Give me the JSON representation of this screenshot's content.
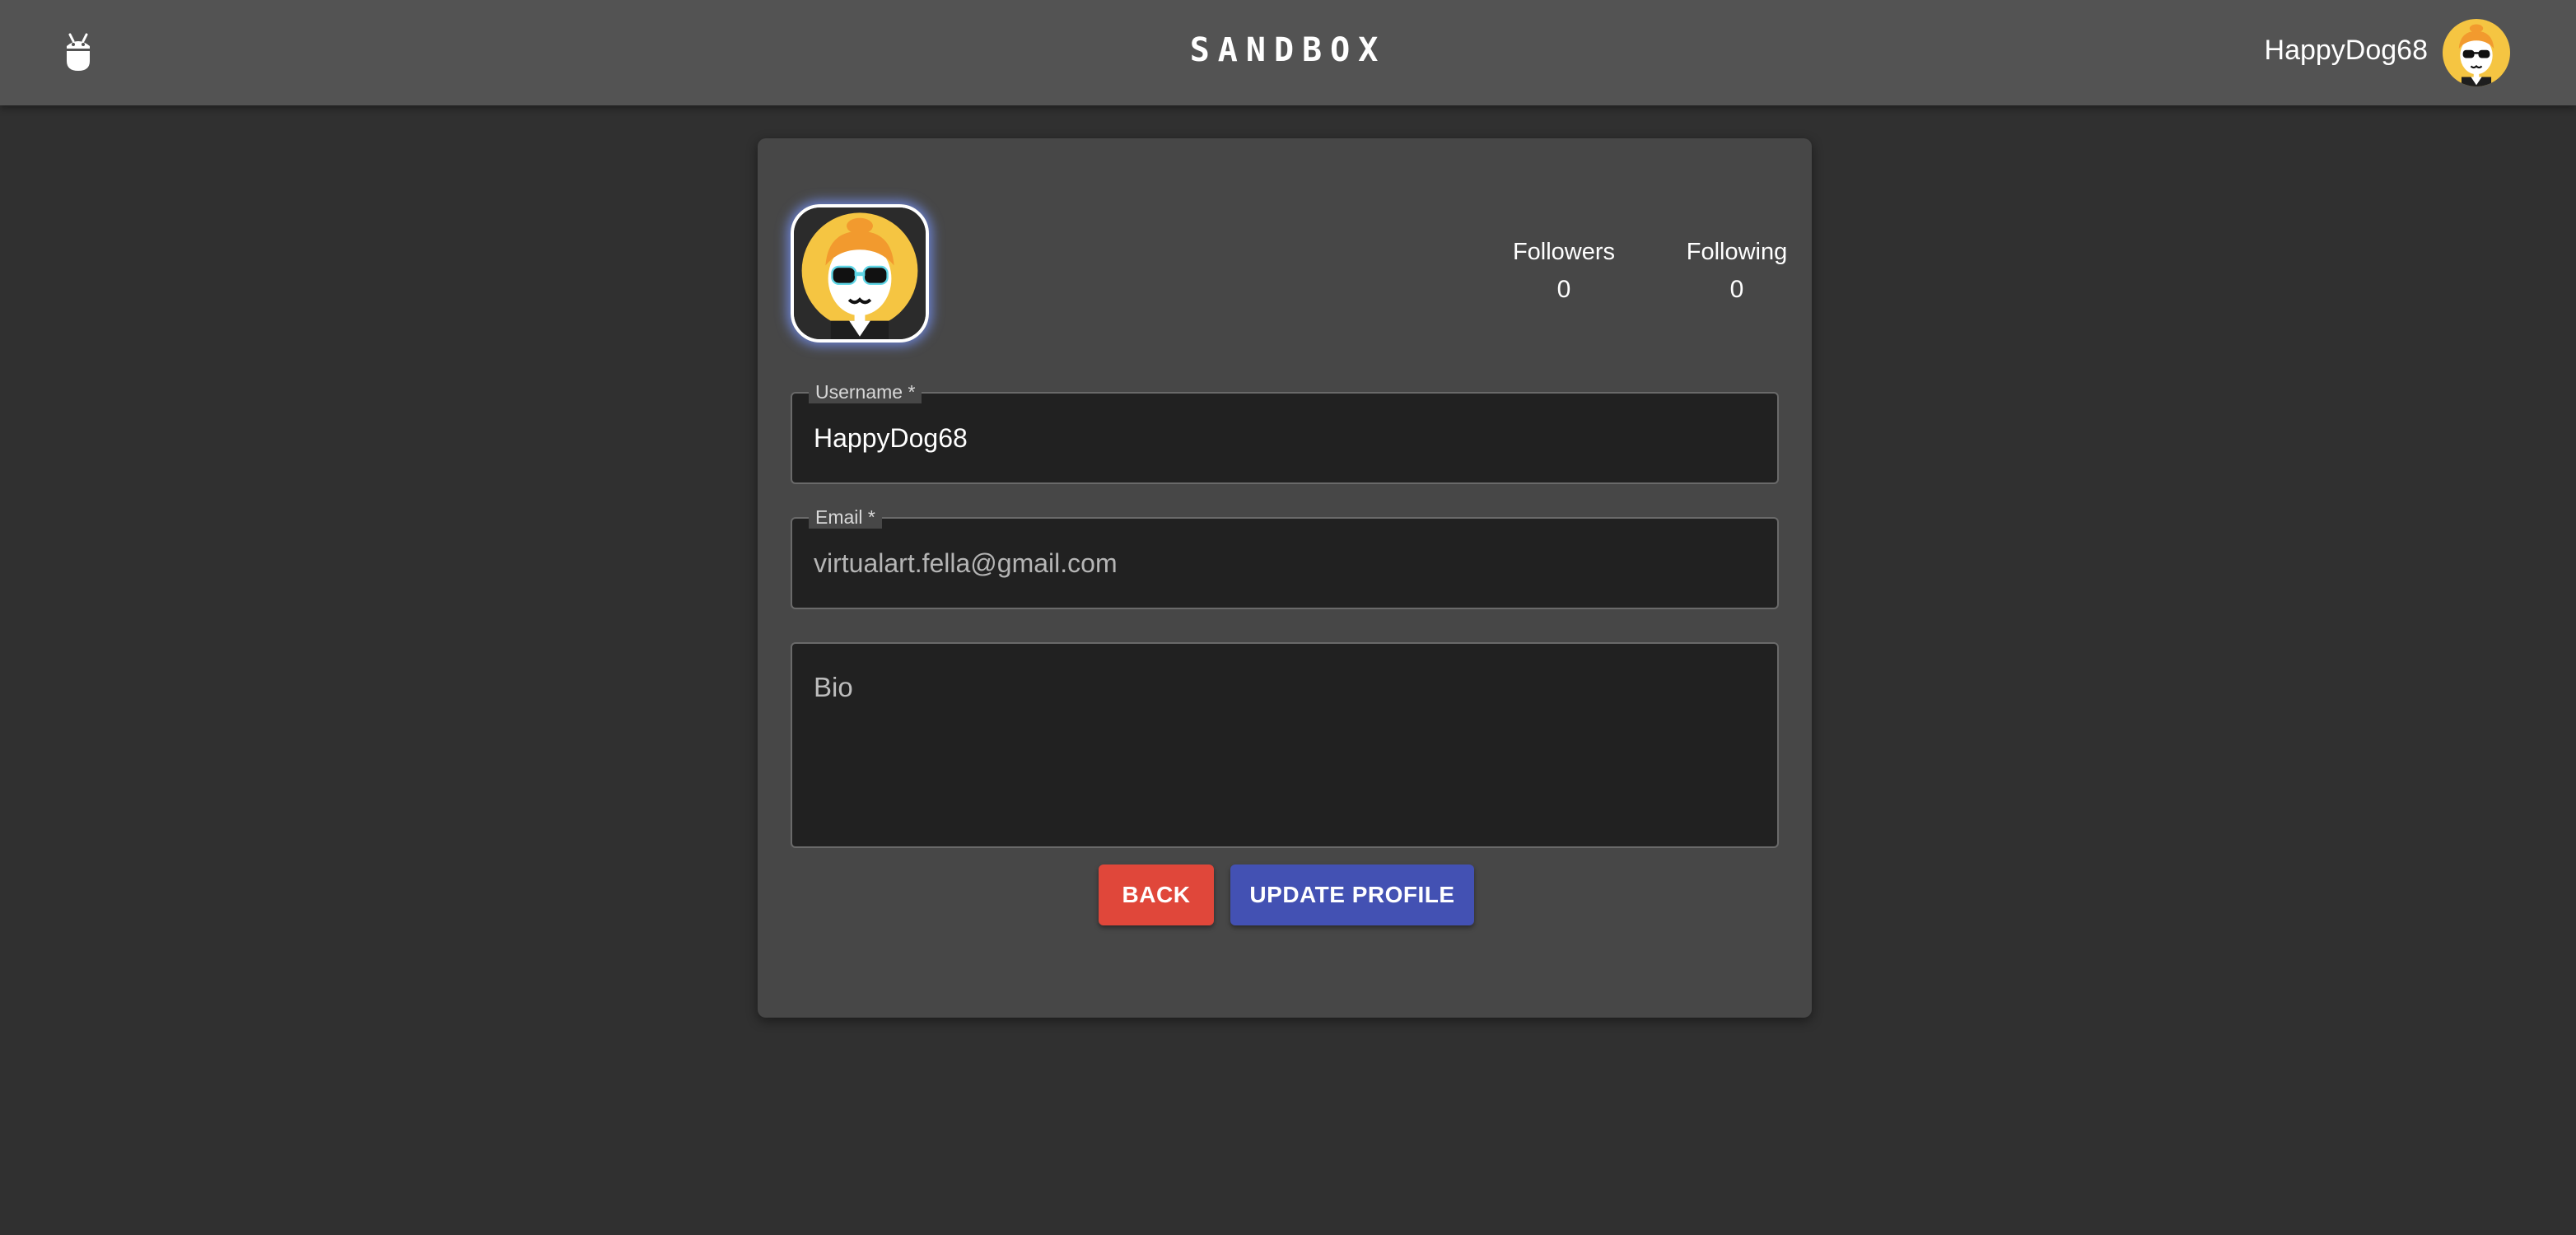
{
  "header": {
    "brand": "SANDBOX",
    "username": "HappyDog68",
    "logo_icon": "bug-robot-icon",
    "avatar_icon": "avatar-sunglasses-icon"
  },
  "profile": {
    "avatar_icon": "avatar-sunglasses-icon",
    "followers_label": "Followers",
    "followers_count": "0",
    "following_label": "Following",
    "following_count": "0"
  },
  "form": {
    "username_label": "Username *",
    "username_value": "HappyDog68",
    "email_label": "Email *",
    "email_value": "virtualart.fella@gmail.com",
    "bio_placeholder": "Bio"
  },
  "actions": {
    "back_label": "BACK",
    "update_label": "UPDATE PROFILE"
  },
  "colors": {
    "topbar": "#535353",
    "background": "#303030",
    "card": "#474747",
    "field": "#212121",
    "back_button": "#e0473a",
    "update_button": "#4351b3",
    "avatar_yellow": "#f5c542",
    "avatar_glow": "#7896ff"
  }
}
